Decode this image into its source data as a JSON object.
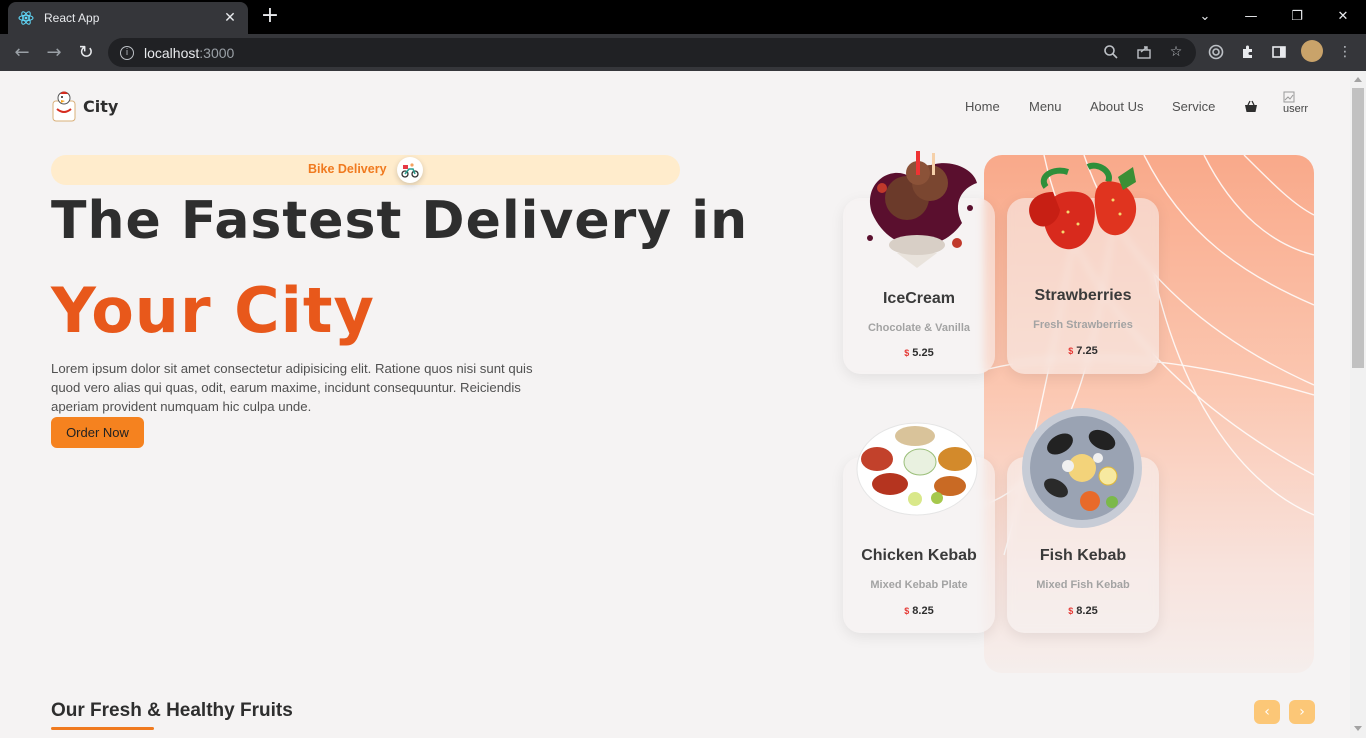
{
  "browser": {
    "tab_title": "React App",
    "url_host": "localhost",
    "url_port": ":3000"
  },
  "brand": {
    "name": "City"
  },
  "nav": {
    "items": [
      "Home",
      "Menu",
      "About Us",
      "Service"
    ],
    "avatar_alt": "userr"
  },
  "hero": {
    "pill_label": "Bike Delivery",
    "headline_line1": "The Fastest Delivery in",
    "headline_line2": "Your City",
    "description": "Lorem ipsum dolor sit amet consectetur adipisicing elit. Ratione quos nisi sunt quis quod vero alias qui quas, odit, earum maxime, incidunt consequuntur. Reiciendis aperiam provident numquam hic culpa unde.",
    "cta": "Order Now"
  },
  "cards": [
    {
      "name": "IceCream",
      "desc": "Chocolate & Vanilla",
      "currency": "$",
      "price": "5.25"
    },
    {
      "name": "Strawberries",
      "desc": "Fresh Strawberries",
      "currency": "$",
      "price": "7.25"
    },
    {
      "name": "Chicken Kebab",
      "desc": "Mixed Kebab Plate",
      "currency": "$",
      "price": "8.25"
    },
    {
      "name": "Fish Kebab",
      "desc": "Mixed Fish Kebab",
      "currency": "$",
      "price": "8.25"
    }
  ],
  "section": {
    "title": "Our Fresh & Healthy Fruits",
    "prev": "‹",
    "next": "›"
  },
  "colors": {
    "accent": "#e8581b",
    "button": "#f5821f",
    "pill_bg": "#ffeccc",
    "arrow_bg": "#fcc777"
  }
}
